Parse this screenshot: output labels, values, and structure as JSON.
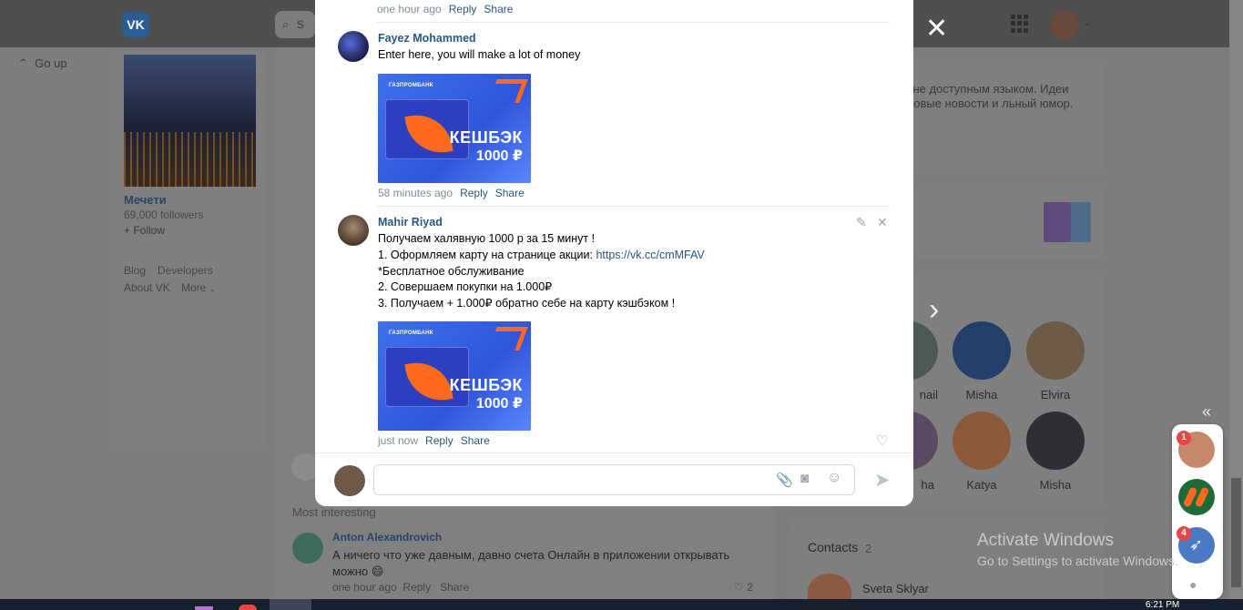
{
  "background": {
    "logo": "VK",
    "search_placeholder": "S",
    "go_up": "Go up",
    "community": {
      "name": "Мечети",
      "followers": "69,000 followers",
      "follow": "+ Follow"
    },
    "footer_links": [
      "Blog",
      "Developers",
      "About VK",
      "More"
    ],
    "right_text": "сне доступным языком. Идеи ровые новости и льный юмор.",
    "people": [
      {
        "name": "nail"
      },
      {
        "name": "Misha"
      },
      {
        "name": "Elvira"
      },
      {
        "name": "ha"
      },
      {
        "name": "Katya"
      },
      {
        "name": "Misha"
      }
    ],
    "most_interesting": "Most interesting",
    "comment": {
      "author": "Anton Alexandrovich",
      "text": "А ничего что уже давным, давно счета Онлайн в приложении открывать можно 😄",
      "time": "one hour ago",
      "reply": "Reply",
      "share": "Share",
      "likes": "2"
    },
    "contacts": {
      "title": "Contacts",
      "count": "2",
      "first": "Sveta Sklyar"
    },
    "watermark": {
      "title": "Activate Windows",
      "subtitle": "Go to Settings to activate Windows."
    },
    "taskbar_time": "6:21 PM"
  },
  "chat_rail": {
    "badges": [
      "1",
      "4"
    ]
  },
  "modal": {
    "top_meta": {
      "time": "one hour ago",
      "reply": "Reply",
      "share": "Share"
    },
    "comments": [
      {
        "author": "Fayez Mohammed",
        "text": "Enter here, you will make a lot of money",
        "time": "58 minutes ago",
        "reply": "Reply",
        "share": "Share"
      },
      {
        "author": "Mahir Riyad",
        "lines": [
          "Получаем халявную 1000 р за 15 минут !",
          "1. Оформляем карту на странице акции: ",
          "*Бесплатное обслуживание",
          "2. Совершаем покупки на 1.000₽",
          "3. Получаем + 1.000₽ обратно себе на карту кэшбэком !"
        ],
        "link": "https://vk.cc/cmMFAV",
        "time": "just now",
        "reply": "Reply",
        "share": "Share"
      }
    ],
    "promo": {
      "bank": "ГАЗПРОМБАНК",
      "cashback": "КЕШБЭК",
      "amount": "1000 ₽"
    }
  },
  "colors": {
    "link": "#2a5885",
    "accent": "#ff6a1f",
    "promo_blue": "#3e72f2",
    "annotation": "#e01010"
  }
}
